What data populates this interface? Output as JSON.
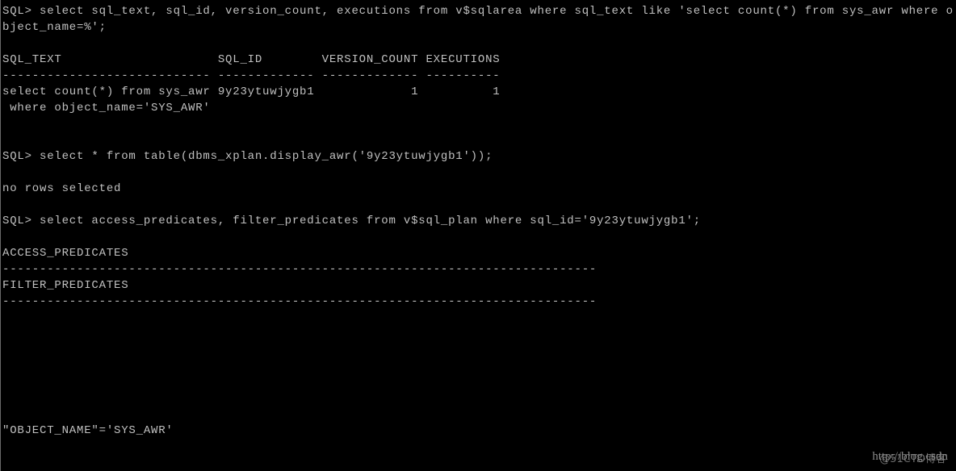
{
  "terminal": {
    "lines": [
      "SQL> select sql_text, sql_id, version_count, executions from v$sqlarea where sql_text like 'select count(*) from sys_awr where o",
      "bject_name=%';",
      "",
      "SQL_TEXT                     SQL_ID        VERSION_COUNT EXECUTIONS",
      "---------------------------- ------------- ------------- ----------",
      "select count(*) from sys_awr 9y23ytuwjygb1             1          1",
      " where object_name='SYS_AWR'",
      "",
      "",
      "SQL> select * from table(dbms_xplan.display_awr('9y23ytuwjygb1'));",
      "",
      "no rows selected",
      "",
      "SQL> select access_predicates, filter_predicates from v$sql_plan where sql_id='9y23ytuwjygb1';",
      "",
      "ACCESS_PREDICATES",
      "--------------------------------------------------------------------------------",
      "FILTER_PREDICATES",
      "--------------------------------------------------------------------------------",
      "",
      "",
      "",
      "",
      "",
      "",
      "",
      "\"OBJECT_NAME\"='SYS_AWR'"
    ],
    "text_color": "#c0c0c0",
    "background": "#000000"
  },
  "watermark": {
    "url": "http://blog.csdn",
    "overlay": "@51CTO博客"
  }
}
